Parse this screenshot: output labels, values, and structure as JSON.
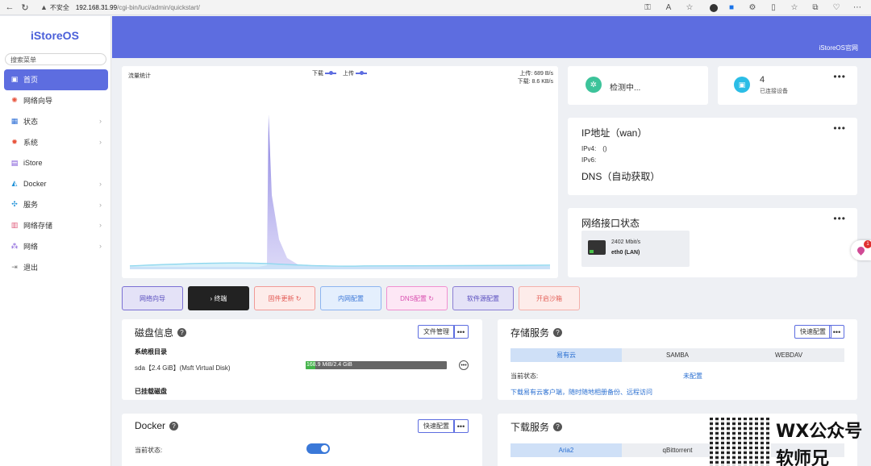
{
  "browser": {
    "insecure_label": "不安全",
    "host": "192.168.31.99",
    "path": "/cgi-bin/luci/admin/quickstart/"
  },
  "sidebar": {
    "logo": "iStoreOS",
    "search_placeholder": "搜索菜单",
    "items": [
      {
        "label": "首页",
        "icon": "home-icon",
        "active": true,
        "has_chevron": false
      },
      {
        "label": "网络向导",
        "icon": "wizard-icon",
        "active": false,
        "has_chevron": false
      },
      {
        "label": "状态",
        "icon": "dashboard-icon",
        "active": false,
        "has_chevron": true
      },
      {
        "label": "系统",
        "icon": "gear-icon",
        "active": false,
        "has_chevron": true
      },
      {
        "label": "iStore",
        "icon": "store-icon",
        "active": false,
        "has_chevron": false
      },
      {
        "label": "Docker",
        "icon": "docker-icon",
        "active": false,
        "has_chevron": true
      },
      {
        "label": "服务",
        "icon": "services-icon",
        "active": false,
        "has_chevron": true
      },
      {
        "label": "网络存储",
        "icon": "storage-icon",
        "active": false,
        "has_chevron": true
      },
      {
        "label": "网络",
        "icon": "network-icon",
        "active": false,
        "has_chevron": true
      },
      {
        "label": "退出",
        "icon": "logout-icon",
        "active": false,
        "has_chevron": false
      }
    ]
  },
  "header": {
    "link": "iStoreOS官网"
  },
  "traffic": {
    "title": "流量统计",
    "legend_down": "下载",
    "legend_up": "上传",
    "upload_rate": "上传: 689 B/s",
    "download_rate": "下载: 8.6 KB/s"
  },
  "actions": [
    "网络向导",
    "终端",
    "固件更新",
    "内网配置",
    "DNS配置",
    "软件源配置",
    "开启沙箱"
  ],
  "status": {
    "text": "检测中..."
  },
  "devices": {
    "count": "4",
    "label": "已连接设备"
  },
  "ip": {
    "title": "IP地址（wan）",
    "ipv4": "IPv4:　()",
    "ipv6": "IPv6:",
    "dns": "DNS（自动获取）"
  },
  "network_ports": {
    "title": "网络接口状态",
    "speed": "2402 Mbit/s",
    "name": "eth0 (LAN)"
  },
  "disk": {
    "title": "磁盘信息",
    "manage_button": "文件管理",
    "root_label": "系统根目录",
    "disk_desc": "sda【2.4 GiB】(Msft Virtual Disk)",
    "usage_text": "168.9 MiB/2.4 GiB",
    "usage_fraction": 0.069,
    "mounted_label": "已挂载磁盘"
  },
  "storage": {
    "title": "存储服务",
    "config_button": "快速配置",
    "tabs": [
      "易有云",
      "SAMBA",
      "WEBDAV"
    ],
    "state_label": "当前状态:",
    "state_value": "未配置",
    "note": "下载易有云客户端，随时随地相册备份、远程访问"
  },
  "docker": {
    "title": "Docker",
    "config_button": "快速配置",
    "state_label": "当前状态:"
  },
  "download": {
    "title": "下载服务",
    "tabs": [
      "Aria2",
      "qBittorrent"
    ]
  },
  "float": {
    "badge": "1"
  },
  "watermark": {
    "line1": "WX公众号",
    "line2": "软师兄"
  }
}
